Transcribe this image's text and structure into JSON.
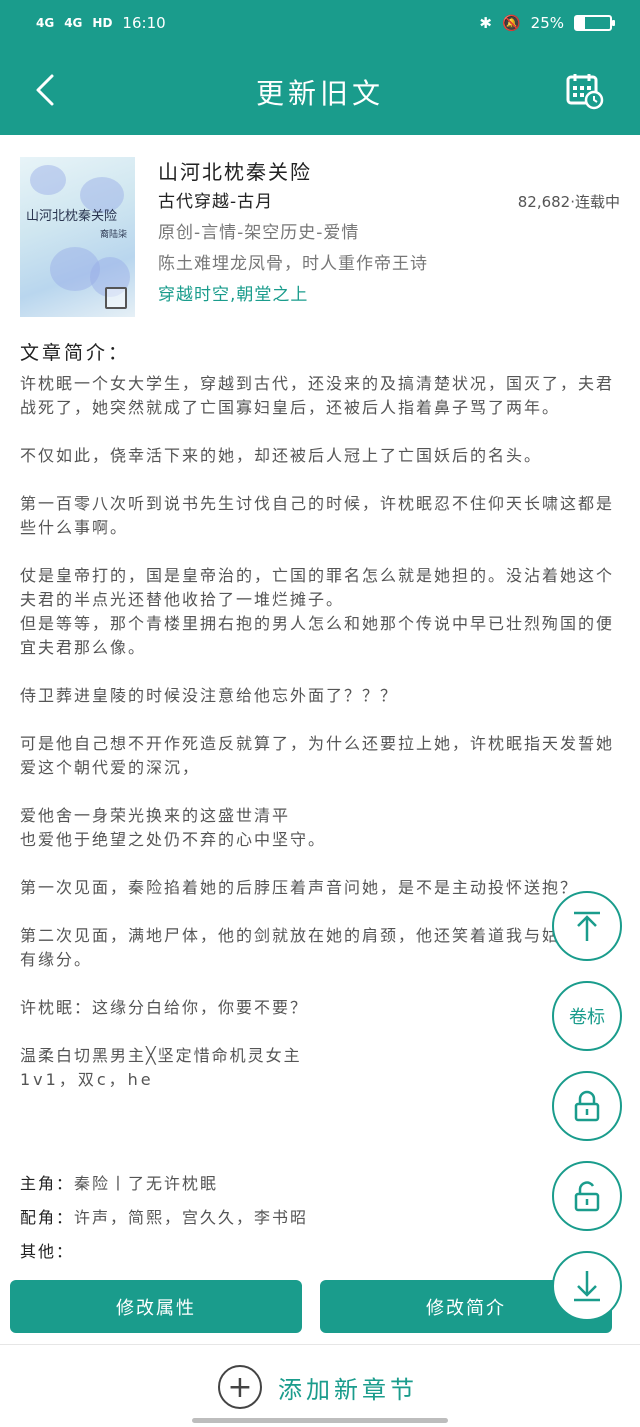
{
  "status": {
    "left_network": "4G",
    "left_network2": "4G",
    "hd": "HD",
    "time": "16:10",
    "battery": "25%"
  },
  "appbar": {
    "title": "更新旧文"
  },
  "book": {
    "cover_title": "山河北枕秦关险",
    "cover_author": "裔陆柒",
    "title": "山河北枕秦关险",
    "genre": "古代穿越-古月",
    "stats": "82,682·连载中",
    "tags": "原创-言情-架空历史-爱情",
    "tagline": "陈土难埋龙凤骨，时人重作帝王诗",
    "theme": "穿越时空,朝堂之上"
  },
  "intro": {
    "heading": "文章简介：",
    "p1": "许枕眠一个女大学生，穿越到古代，还没来的及搞清楚状况，国灭了，夫君战死了，她突然就成了亡国寡妇皇后，还被后人指着鼻子骂了两年。",
    "p2": "不仅如此，侥幸活下来的她，却还被后人冠上了亡国妖后的名头。",
    "p3": "第一百零八次听到说书先生讨伐自己的时候，许枕眠忍不住仰天长啸这都是些什么事啊。",
    "p4": "仗是皇帝打的，国是皇帝治的，亡国的罪名怎么就是她担的。没沾着她这个夫君的半点光还替他收拾了一堆烂摊子。",
    "p5": "但是等等，那个青楼里拥右抱的男人怎么和她那个传说中早已壮烈殉国的便宜夫君那么像。",
    "p6": "侍卫葬进皇陵的时候没注意给他忘外面了？？？",
    "p7": "可是他自己想不开作死造反就算了，为什么还要拉上她，许枕眠指天发誓她爱这个朝代爱的深沉，",
    "p8": "爱他舍一身荣光换来的这盛世清平",
    "p9": "也爱他于绝望之处仍不弃的心中坚守。",
    "p10": "第一次见面，秦险掐着她的后脖压着声音问她，是不是主动投怀送抱？",
    "p11": "第二次见面，满地尸体，他的剑就放在她的肩颈，他还笑着道我与姑娘真是有缘分。",
    "p12": "许枕眠：这缘分白给你，你要不要？",
    "p13": "温柔白切黑男主╳坚定惜命机灵女主",
    "p14": "1v1，双c，he"
  },
  "meta": {
    "lead_label": "主角：",
    "lead_value": "秦险丨了无许枕眠",
    "support_label": "配角：",
    "support_value": "许声，简熙，宫久久，李书昭",
    "other_label": "其他：",
    "other_value": ""
  },
  "buttons": {
    "edit_attr": "修改属性",
    "edit_intro": "修改简介"
  },
  "fabs": {
    "volume_label": "卷标"
  },
  "bottom": {
    "add_chapter": "添加新章节"
  }
}
